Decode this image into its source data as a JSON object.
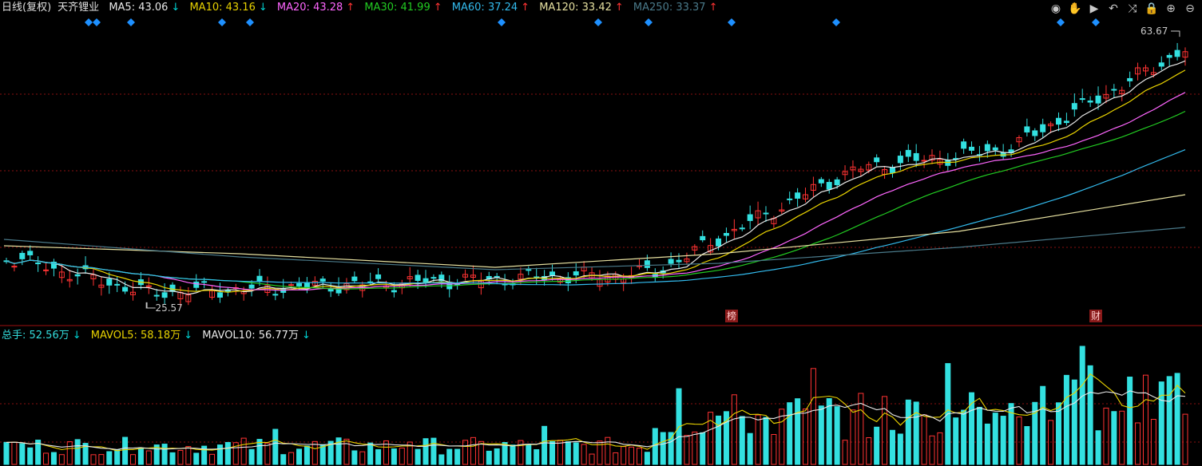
{
  "header": {
    "period_label": "日线(复权)",
    "stock_name": "天齐锂业",
    "ma": [
      {
        "label": "MA5: 43.06",
        "arrow": "↓",
        "color": "#e8e8e8"
      },
      {
        "label": "MA10: 43.16",
        "arrow": "↓",
        "color": "#e8d200"
      },
      {
        "label": "MA20: 43.28",
        "arrow": "↑",
        "color": "#ff66ff"
      },
      {
        "label": "MA30: 41.99",
        "arrow": "↑",
        "color": "#22cc22"
      },
      {
        "label": "MA60: 37.24",
        "arrow": "↑",
        "color": "#33bbee"
      },
      {
        "label": "MA120: 33.42",
        "arrow": "↑",
        "color": "#e6e0a0"
      },
      {
        "label": "MA250: 33.37",
        "arrow": "↑",
        "color": "#4a7a8a"
      }
    ]
  },
  "toolbar": {
    "icons": [
      "eye-icon",
      "hand-icon",
      "play-icon",
      "undo-icon",
      "shuffle-icon",
      "lock-icon",
      "zoom-in-icon",
      "zoom-out-icon"
    ],
    "glyphs": [
      "◉",
      "✋",
      "▶",
      "↶",
      "⤨",
      "🔒",
      "⊕",
      "⊖"
    ]
  },
  "price_panel": {
    "high_label": "63.67",
    "low_label": "25.57",
    "badge_bang": "榜",
    "badge_cai": "财"
  },
  "volume_panel": {
    "items": [
      {
        "label": "总手: 52.56万",
        "arrow": "↓",
        "color": "#33dddd"
      },
      {
        "label": "MAVOL5: 58.18万",
        "arrow": "↓",
        "color": "#e8d200"
      },
      {
        "label": "MAVOL10: 56.77万",
        "arrow": "↓",
        "color": "#e8e8e8"
      }
    ]
  },
  "colors": {
    "up": "#ff3333",
    "down": "#33e0e0",
    "grid": "#8a1010",
    "marker": "#1e90ff"
  }
}
